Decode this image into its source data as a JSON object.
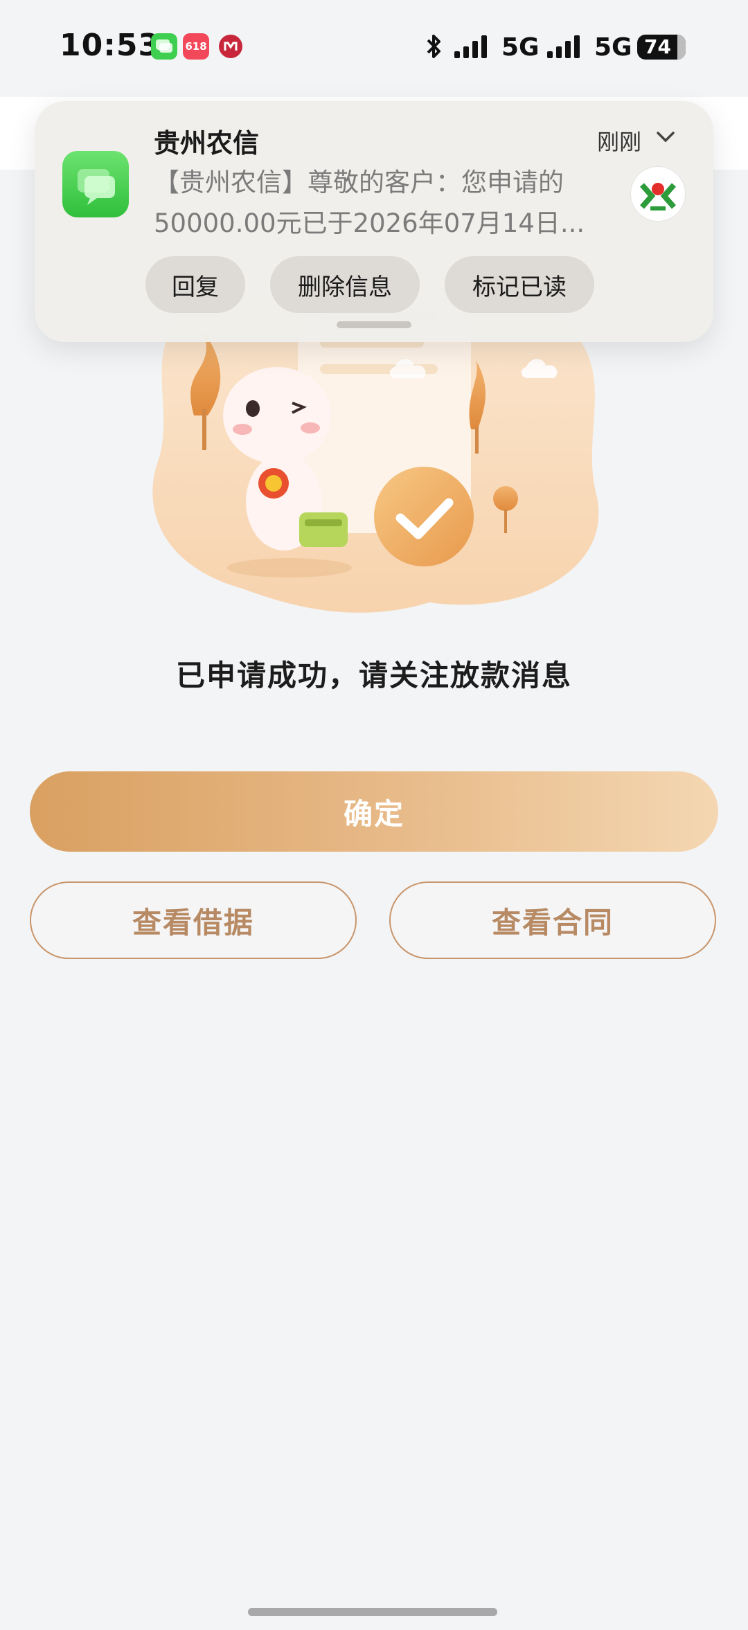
{
  "status_bar": {
    "time": "10:53",
    "network_1": "5G",
    "network_2": "5G",
    "battery": "74",
    "app_badge": "618",
    "icons": [
      "messages-icon",
      "taobao-618-icon",
      "bank-icon",
      "bluetooth-icon",
      "signal-icon",
      "battery-icon"
    ]
  },
  "notification": {
    "sender": "贵州农信",
    "time": "刚刚",
    "body_line1": "【贵州农信】尊敬的客户：您申请的",
    "body_line2": "50000.00元已于2026年07月14日...",
    "actions": [
      {
        "label": "回复"
      },
      {
        "label": "删除信息"
      },
      {
        "label": "标记已读"
      }
    ]
  },
  "result": {
    "title": "已申请成功，请关注放款消息"
  },
  "buttons": {
    "confirm": "确定",
    "view_iou": "查看借据",
    "view_contract": "查看合同"
  },
  "colors": {
    "accent": "#d9a061",
    "outline": "#c9956a",
    "outline_text": "#b78a64",
    "background": "#f3f4f6"
  }
}
